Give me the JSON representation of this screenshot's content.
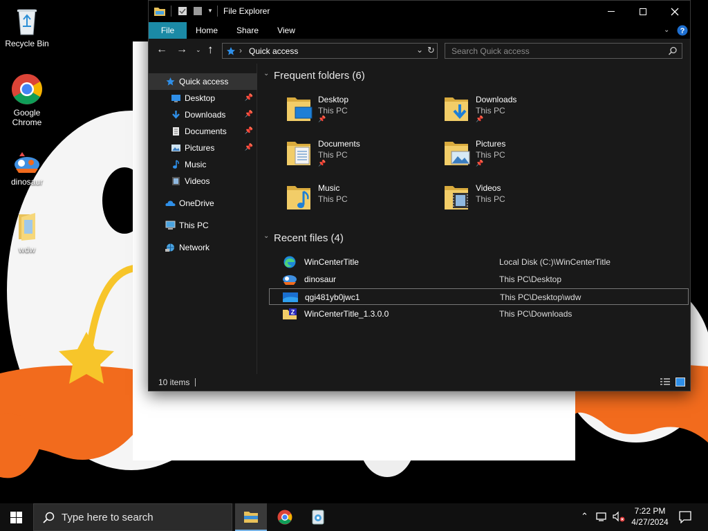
{
  "desktop": {
    "icons": [
      {
        "label": "Recycle Bin",
        "icon": "recycle-bin-icon"
      },
      {
        "label": "Google Chrome",
        "icon": "chrome-icon"
      },
      {
        "label": "dinosaur",
        "icon": "dinosaur-icon"
      },
      {
        "label": "wdw",
        "icon": "folder-icon"
      }
    ]
  },
  "explorer": {
    "title": "File Explorer",
    "ribbon_tabs": [
      "File",
      "Home",
      "Share",
      "View"
    ],
    "address": {
      "location": "Quick access"
    },
    "search": {
      "placeholder": "Search Quick access"
    },
    "nav": [
      {
        "label": "Quick access",
        "icon": "star-icon"
      },
      {
        "label": "Desktop",
        "icon": "desktop-icon",
        "pinned": "📌"
      },
      {
        "label": "Downloads",
        "icon": "download-icon",
        "pinned": "📌"
      },
      {
        "label": "Documents",
        "icon": "document-icon",
        "pinned": "📌"
      },
      {
        "label": "Pictures",
        "icon": "pictures-icon",
        "pinned": "📌"
      },
      {
        "label": "Music",
        "icon": "music-icon"
      },
      {
        "label": "Videos",
        "icon": "videos-icon"
      },
      {
        "label": "OneDrive",
        "icon": "onedrive-icon"
      },
      {
        "label": "This PC",
        "icon": "this-pc-icon"
      },
      {
        "label": "Network",
        "icon": "network-icon"
      }
    ],
    "frequent_header": "Frequent folders (6)",
    "frequent": [
      {
        "name": "Desktop",
        "location": "This PC",
        "icon": "desktop-folder-icon"
      },
      {
        "name": "Downloads",
        "location": "This PC",
        "icon": "downloads-folder-icon"
      },
      {
        "name": "Documents",
        "location": "This PC",
        "icon": "documents-folder-icon"
      },
      {
        "name": "Pictures",
        "location": "This PC",
        "icon": "pictures-folder-icon"
      },
      {
        "name": "Music",
        "location": "This PC",
        "icon": "music-folder-icon"
      },
      {
        "name": "Videos",
        "location": "This PC",
        "icon": "videos-folder-icon"
      }
    ],
    "pin_glyph": "📌",
    "recent_header": "Recent files (4)",
    "recent": [
      {
        "name": "WinCenterTitle",
        "path": "Local Disk (C:)\\WinCenterTitle",
        "icon": "edge-icon"
      },
      {
        "name": "dinosaur",
        "path": "This PC\\Desktop",
        "icon": "dinosaur-icon"
      },
      {
        "name": "qgi481yb0jwc1",
        "path": "This PC\\Desktop\\wdw",
        "icon": "image-file-icon"
      },
      {
        "name": "WinCenterTitle_1.3.0.0",
        "path": "This PC\\Downloads",
        "icon": "zip-icon"
      }
    ],
    "status": {
      "items": "10 items"
    }
  },
  "taskbar": {
    "search_placeholder": "Type here to search",
    "clock": {
      "time": "7:22 PM",
      "date": "4/27/2024"
    }
  },
  "colors": {
    "accent": "#0f8fa8",
    "selection_border": "#777777",
    "folder": "#e8c15a"
  }
}
